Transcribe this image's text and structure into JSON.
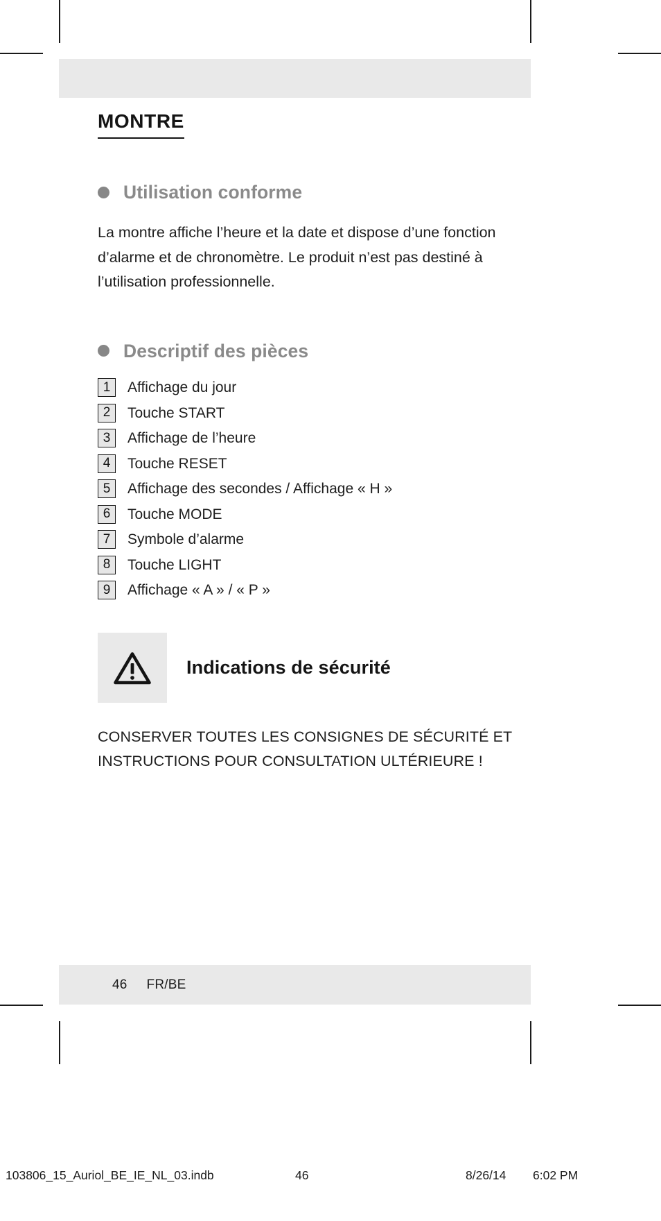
{
  "document": {
    "title": "MONTRE",
    "language_footer": "FR/BE",
    "page_number": "46"
  },
  "sections": [
    {
      "bullet_icon": "filled-circle-bullet",
      "heading": "Utilisation conforme",
      "paragraph": "La montre affiche l’heure et la date et dispose d’une fonction d’alarme et de chronomètre. Le produit n’est pas destiné à l’utilisation professionnelle."
    },
    {
      "bullet_icon": "filled-circle-bullet",
      "heading": "Descriptif des pièces"
    }
  ],
  "parts_list": [
    {
      "number": "1",
      "label": "Affichage du jour"
    },
    {
      "number": "2",
      "label": "Touche START"
    },
    {
      "number": "3",
      "label": "Affichage de l’heure"
    },
    {
      "number": "4",
      "label": "Touche RESET"
    },
    {
      "number": "5",
      "label": "Affichage des secondes / Affichage « H »"
    },
    {
      "number": "6",
      "label": "Touche MODE"
    },
    {
      "number": "7",
      "label": "Symbole d’alarme"
    },
    {
      "number": "8",
      "label": "Touche LIGHT"
    },
    {
      "number": "9",
      "label": "Affichage « A » / « P »"
    }
  ],
  "safety": {
    "icon": "warning-triangle-icon",
    "heading": "Indications de sécurité",
    "text": "CONSERVER TOUTES LES CONSIGNES DE SÉCURITÉ ET INSTRUCTIONS POUR CONSULTATION ULTÉRIEURE !"
  },
  "footer": {
    "page_number": "46",
    "locale": "FR/BE"
  },
  "print_slug": {
    "filename": "103806_15_Auriol_BE_IE_NL_03.indb",
    "page_number": "46",
    "date": "8/26/14",
    "time": "6:02 PM"
  },
  "colors": {
    "band_gray": "#e9e9e9",
    "heading_gray": "#8a8a8a",
    "text_black": "#1e1e1e",
    "numbox_fill": "#e6e6e6"
  }
}
